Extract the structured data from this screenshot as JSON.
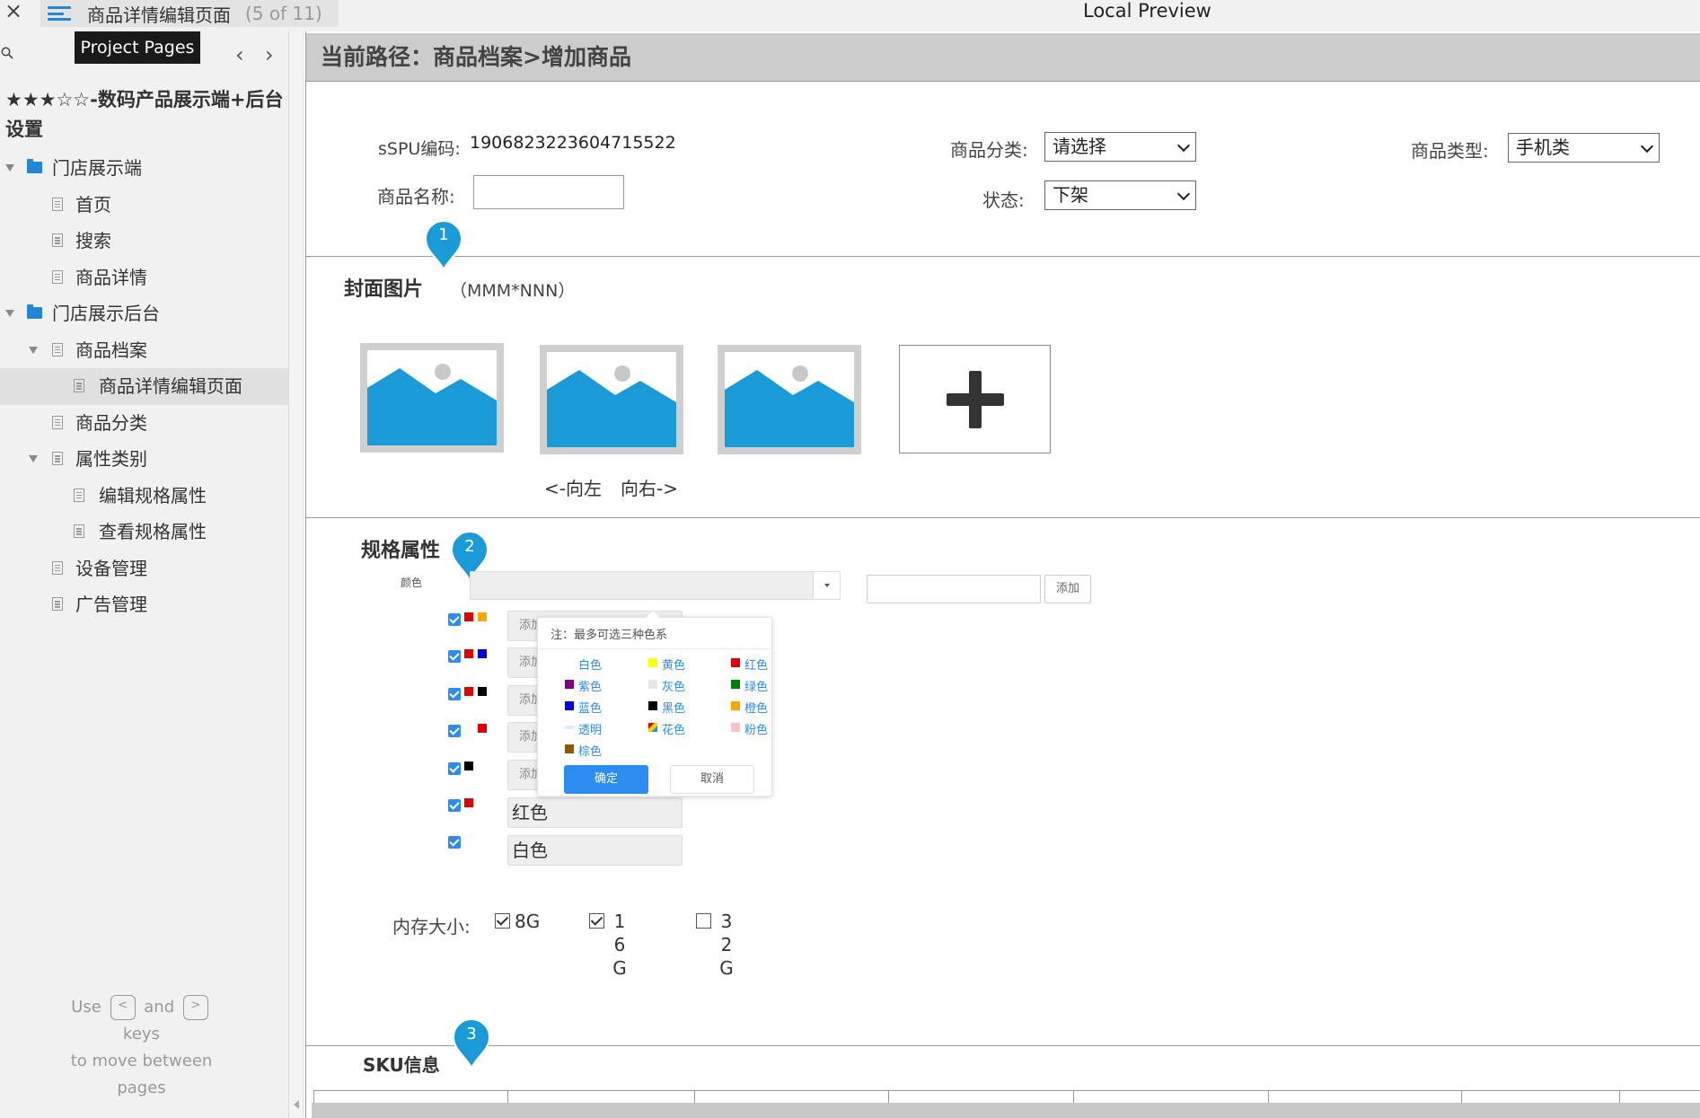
{
  "topbar": {
    "close_icon": "×",
    "page_tab_title": "商品详情编辑页面",
    "page_tab_count": "(5 of 11)",
    "preview_title": "Local Preview"
  },
  "sidebar": {
    "tooltip": "Project Pages",
    "prev_arrow": "‹",
    "next_arrow": "›",
    "project_title": "★★★☆☆-数码产品展示端+后台设置",
    "items": [
      {
        "label": "门店展示端",
        "type": "folder",
        "level": 0,
        "expanded": true
      },
      {
        "label": "首页",
        "type": "page",
        "level": 1
      },
      {
        "label": "搜索",
        "type": "page",
        "level": 1
      },
      {
        "label": "商品详情",
        "type": "page",
        "level": 1
      },
      {
        "label": "门店展示后台",
        "type": "folder",
        "level": 0,
        "expanded": true
      },
      {
        "label": "商品档案",
        "type": "page",
        "level": 1,
        "expanded": true
      },
      {
        "label": "商品详情编辑页面",
        "type": "page",
        "level": 2,
        "selected": true
      },
      {
        "label": "商品分类",
        "type": "page",
        "level": 1
      },
      {
        "label": "属性类别",
        "type": "page",
        "level": 1,
        "expanded": true
      },
      {
        "label": "编辑规格属性",
        "type": "page",
        "level": 2
      },
      {
        "label": "查看规格属性",
        "type": "page",
        "level": 2
      },
      {
        "label": "设备管理",
        "type": "page",
        "level": 1
      },
      {
        "label": "广告管理",
        "type": "page",
        "level": 1
      }
    ],
    "help": {
      "use": "Use",
      "key_prev": "<",
      "and": "and",
      "key_next": ">",
      "keys": "keys",
      "to_move": "to move between",
      "pages": "pages"
    }
  },
  "main": {
    "breadcrumb": "当前路径：商品档案>增加商品",
    "spu_label": "sSPU编码:",
    "spu_value": "1906823223604715522",
    "name_label": "商品名称:",
    "name_value": "",
    "category_label": "商品分类:",
    "category_value": "请选择",
    "type_label": "商品类型:",
    "type_value": "手机类",
    "status_label": "状态:",
    "status_value": "下架",
    "cover_title": "封面图片",
    "cover_size": "（MMM*NNN）",
    "nav_left": "<-向左",
    "nav_right": "向右->",
    "spec_title": "规格属性",
    "color_label": "颜色",
    "add_button": "添加",
    "row_placeholder": "添加",
    "row_value_red": "红色",
    "row_value_white": "白色",
    "memory_label": "内存大小:",
    "memory_options": [
      {
        "label": "8G",
        "checked": true
      },
      {
        "label": "16G",
        "checked": true
      },
      {
        "label": "32G",
        "checked": false
      }
    ],
    "sku_title": "SKU信息",
    "markers": [
      "1",
      "2",
      "3"
    ]
  },
  "color_popup": {
    "note": "注：最多可选三种色系",
    "options": [
      {
        "name": "白色",
        "color": "#ffffff"
      },
      {
        "name": "黄色",
        "color": "#ffff00"
      },
      {
        "name": "红色",
        "color": "#e00000"
      },
      {
        "name": "紫色",
        "color": "#800080"
      },
      {
        "name": "灰色",
        "color": "#e6e6e6"
      },
      {
        "name": "绿色",
        "color": "#008000"
      },
      {
        "name": "蓝色",
        "color": "#0000e0"
      },
      {
        "name": "黑色",
        "color": "#000000"
      },
      {
        "name": "橙色",
        "color": "#ffa500"
      },
      {
        "name": "透明",
        "color": "#dfe9ff"
      },
      {
        "name": "花色",
        "color": "multicolor"
      },
      {
        "name": "粉色",
        "color": "#ffc0cb"
      },
      {
        "name": "棕色",
        "color": "#8b5a00"
      }
    ],
    "ok": "确定",
    "cancel": "取消"
  },
  "colors": {
    "accent": "#2d8cf0",
    "pin": "#1a9bd7",
    "image_placeholder": "#1a9bd7"
  }
}
